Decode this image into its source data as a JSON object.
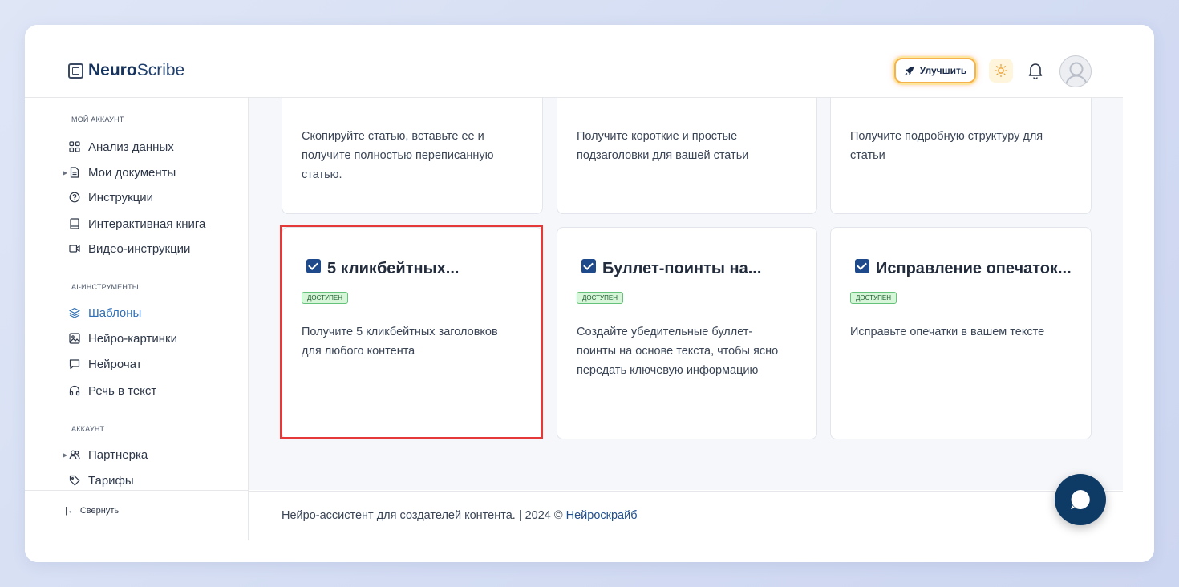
{
  "header": {
    "logo_bold": "Neuro",
    "logo_light": "Scribe",
    "upgrade_label": "Улучшить"
  },
  "sidebar": {
    "section_account": "МОЙ АККАУНТ",
    "items_account": [
      {
        "label": "Анализ данных",
        "icon": "grid-icon"
      },
      {
        "label": "Мои документы",
        "icon": "document-icon"
      },
      {
        "label": "Инструкции",
        "icon": "help-circle-icon"
      },
      {
        "label": "Интерактивная книга",
        "icon": "book-icon"
      },
      {
        "label": "Видео-инструкции",
        "icon": "video-icon"
      }
    ],
    "section_ai": "AI-ИНСТРУМЕНТЫ",
    "items_ai": [
      {
        "label": "Шаблоны",
        "icon": "layers-icon"
      },
      {
        "label": "Нейро-картинки",
        "icon": "image-icon"
      },
      {
        "label": "Нейрочат",
        "icon": "chat-icon"
      },
      {
        "label": "Речь в текст",
        "icon": "headphones-icon"
      }
    ],
    "section_acc2": "АККАУНТ",
    "items_acc2": [
      {
        "label": "Партнерка",
        "icon": "users-icon"
      },
      {
        "label": "Тарифы",
        "icon": "tag-icon"
      }
    ],
    "collapse_label": "Свернуть"
  },
  "cards_top": [
    {
      "desc": "Скопируйте статью, вставьте ее и получите полностью переписанную статью."
    },
    {
      "desc": "Получите короткие и простые подзаголовки для вашей статьи"
    },
    {
      "desc": "Получите подробную структуру для статьи"
    }
  ],
  "cards": [
    {
      "title": "5 кликбейтных...",
      "badge": "доступен",
      "desc": "Получите 5 кликбейтных заголовков для любого контента"
    },
    {
      "title": "Буллет-поинты на...",
      "badge": "доступен",
      "desc": "Создайте убедительные буллет-поинты на основе текста, чтобы ясно передать ключевую информацию"
    },
    {
      "title": "Исправление опечаток...",
      "badge": "доступен",
      "desc": "Исправьте опечатки в вашем тексте"
    }
  ],
  "footer": {
    "text": "Нейро-ассистент для создателей контента.  | 2024 © ",
    "link": "Нейроскрайб"
  },
  "colors": {
    "accent": "#2f6fb5",
    "highlight": "#e53838",
    "badge_bg": "#d6f5d9",
    "chat_bubble": "#0e3a66"
  }
}
